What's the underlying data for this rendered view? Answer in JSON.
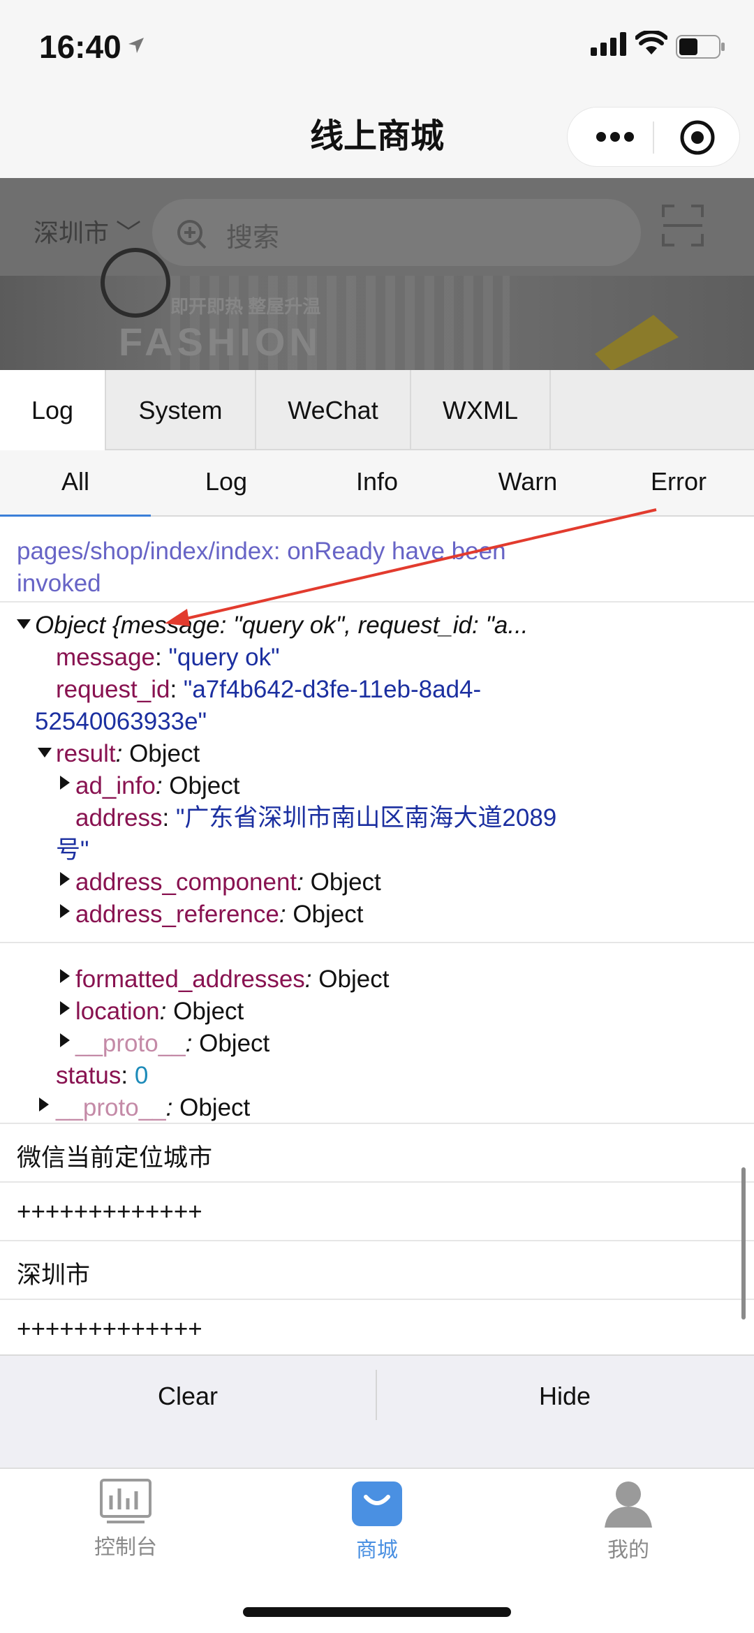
{
  "status_bar": {
    "time": "16:40"
  },
  "nav": {
    "title": "线上商城"
  },
  "page": {
    "city": "深圳市",
    "search_placeholder": "搜索",
    "banner_text": "FASHION",
    "banner_sub": "即开即热 整屋升温"
  },
  "console": {
    "tabs": [
      "Log",
      "System",
      "WeChat",
      "WXML"
    ],
    "filters": [
      "All",
      "Log",
      "Info",
      "Warn",
      "Error"
    ],
    "info_line1": "pages/shop/index/index: onReady have been",
    "info_line2": "invoked",
    "obj_summary": "Object {message: \"query ok\", request_id: \"a...",
    "k_message": "message",
    "v_message": "\"query ok\"",
    "k_request_id": "request_id",
    "v_request_id_1": "\"a7f4b642-d3fe-11eb-8ad4-",
    "v_request_id_2": "52540063933e\"",
    "k_result": "result",
    "k_ad_info": "ad_info",
    "k_address": "address",
    "v_address_1": "\"广东省深圳市南山区南海大道2089",
    "v_address_2": "号\"",
    "k_address_component": "address_component",
    "k_address_reference": "address_reference",
    "k_formatted_addresses": "formatted_addresses",
    "k_location": "location",
    "k_proto": "__proto__",
    "k_status": "status",
    "v_status": "0",
    "obj_word": "Object",
    "log_lines": [
      "微信当前定位城市",
      "+++++++++++++",
      "深圳市",
      "+++++++++++++"
    ],
    "clear_label": "Clear",
    "hide_label": "Hide"
  },
  "tabbar": {
    "items": [
      "控制台",
      "商城",
      "我的"
    ],
    "active_color": "#4a90e2"
  }
}
